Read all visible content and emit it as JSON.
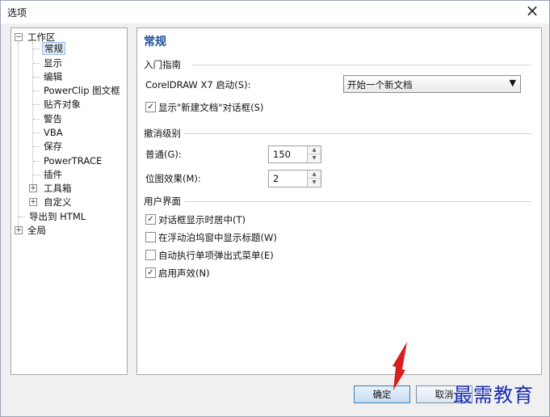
{
  "window": {
    "title": "选项",
    "close_icon": "×"
  },
  "tree": {
    "items": [
      {
        "label": "工作区",
        "toggle": "−"
      },
      {
        "label": "常规"
      },
      {
        "label": "显示"
      },
      {
        "label": "编辑"
      },
      {
        "label": "PowerClip 图文框"
      },
      {
        "label": "贴齐对象"
      },
      {
        "label": "警告"
      },
      {
        "label": "VBA"
      },
      {
        "label": "保存"
      },
      {
        "label": "PowerTRACE"
      },
      {
        "label": "插件"
      },
      {
        "label": "工具箱",
        "toggle": "+"
      },
      {
        "label": "自定义",
        "toggle": "+"
      },
      {
        "label": "导出到 HTML"
      },
      {
        "label": "全局",
        "toggle": "+"
      }
    ]
  },
  "panel": {
    "heading": "常规",
    "groups": {
      "intro": "入门指南",
      "undo": "撤消级别",
      "ui": "用户界面"
    },
    "startup": {
      "label": "CorelDRAW X7 启动(S):",
      "value": "开始一个新文档"
    },
    "show_new_doc": {
      "label": "显示\"新建文档\"对话框(S)",
      "checked": true
    },
    "normal": {
      "label": "普通(G):",
      "value": "150"
    },
    "bitmap": {
      "label": "位图效果(M):",
      "value": "2"
    },
    "ui_options": [
      {
        "label": "对话框显示时居中(T)",
        "checked": true
      },
      {
        "label": "在浮动泊坞窗中显示标题(W)",
        "checked": false
      },
      {
        "label": "自动执行单项弹出式菜单(E)",
        "checked": false
      },
      {
        "label": "启用声效(N)",
        "checked": true
      }
    ],
    "check_mark": "✓"
  },
  "buttons": {
    "ok": "确定",
    "cancel": "取消"
  },
  "watermark": "最需教育",
  "colors": {
    "heading": "#1f4f9a",
    "watermark": "#1a2bb0",
    "pointer": "#d81e1e"
  }
}
